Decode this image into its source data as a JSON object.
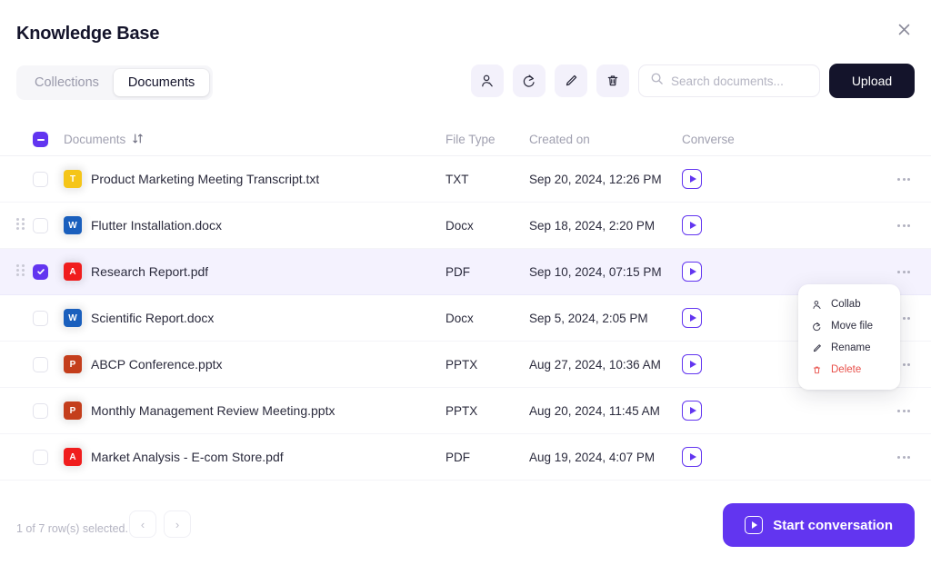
{
  "header": {
    "title": "Knowledge Base",
    "close_icon": "close-icon"
  },
  "tabs": [
    {
      "label": "Collections",
      "active": false
    },
    {
      "label": "Documents",
      "active": true
    }
  ],
  "toolbar": {
    "buttons": [
      {
        "name": "collab-button",
        "icon": "person-icon"
      },
      {
        "name": "move-file-button",
        "icon": "redo-arrow-icon"
      },
      {
        "name": "rename-button",
        "icon": "pencil-icon"
      },
      {
        "name": "delete-button",
        "icon": "trash-icon"
      }
    ],
    "search": {
      "placeholder": "Search documents...",
      "value": "",
      "icon": "search-icon"
    },
    "upload_label": "Upload"
  },
  "table": {
    "columns": [
      "Documents",
      "File Type",
      "Created on",
      "Converse"
    ],
    "header_checkbox_state": "indeterminate",
    "sort_icon": "sort-arrows-icon",
    "rows": [
      {
        "name": "Product Marketing Meeting Transcript.txt",
        "file_type": "TXT",
        "created_on": "Sep 20, 2024, 12:26 PM",
        "icon_letter": "T",
        "icon_color": "#f5c518",
        "selected": false,
        "has_drag_handle": false
      },
      {
        "name": "Flutter Installation.docx",
        "file_type": "Docx",
        "created_on": "Sep 18, 2024, 2:20 PM",
        "icon_letter": "W",
        "icon_color": "#1a5fbd",
        "selected": false,
        "has_drag_handle": true
      },
      {
        "name": "Research Report.pdf",
        "file_type": "PDF",
        "created_on": "Sep 10, 2024, 07:15 PM",
        "icon_letter": "A",
        "icon_color": "#f01d1d",
        "selected": true,
        "has_drag_handle": true
      },
      {
        "name": "Scientific Report.docx",
        "file_type": "Docx",
        "created_on": "Sep 5, 2024, 2:05 PM",
        "icon_letter": "W",
        "icon_color": "#1a5fbd",
        "selected": false,
        "has_drag_handle": false
      },
      {
        "name": "ABCP Conference.pptx",
        "file_type": "PPTX",
        "created_on": "Aug 27, 2024, 10:36 AM",
        "icon_letter": "P",
        "icon_color": "#c43e1c",
        "selected": false,
        "has_drag_handle": false
      },
      {
        "name": "Monthly Management Review Meeting.pptx",
        "file_type": "PPTX",
        "created_on": "Aug 20, 2024, 11:45 AM",
        "icon_letter": "P",
        "icon_color": "#c43e1c",
        "selected": false,
        "has_drag_handle": false
      },
      {
        "name": "Market Analysis - E-com Store.pdf",
        "file_type": "PDF",
        "created_on": "Aug 19, 2024, 4:07 PM",
        "icon_letter": "A",
        "icon_color": "#f01d1d",
        "selected": false,
        "has_drag_handle": false
      }
    ]
  },
  "context_menu": {
    "items": [
      {
        "label": "Collab",
        "icon": "person-icon",
        "danger": false
      },
      {
        "label": "Move file",
        "icon": "redo-arrow-icon",
        "danger": false
      },
      {
        "label": "Rename",
        "icon": "pencil-icon",
        "danger": false
      },
      {
        "label": "Delete",
        "icon": "trash-icon",
        "danger": true
      }
    ]
  },
  "footer": {
    "selection_text": "1 of 7 row(s) selected.",
    "prev_label": "‹",
    "next_label": "›",
    "start_conversation_label": "Start conversation"
  },
  "colors": {
    "accent_purple": "#6235f0",
    "selected_row_bg": "#f4f2fe",
    "dark": "#14142b",
    "danger_red": "#e8504a"
  }
}
